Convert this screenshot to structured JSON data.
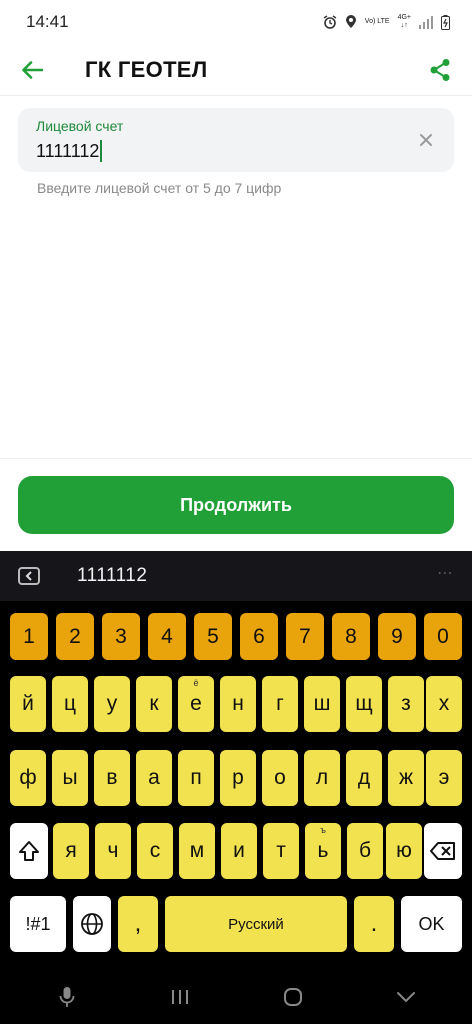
{
  "status": {
    "time": "14:41",
    "net_top": "Vo) LTE",
    "net_mid": "4G+"
  },
  "header": {
    "title": "ГК ГЕОТЕЛ"
  },
  "account_field": {
    "label": "Лицевой счет",
    "value": "1111112",
    "hint": "Введите лицевой счет от 5 до 7 цифр"
  },
  "continue_button": {
    "label": "Продолжить"
  },
  "keyboard": {
    "preview": "1111112",
    "more": "⋯",
    "numbers": [
      "1",
      "2",
      "3",
      "4",
      "5",
      "6",
      "7",
      "8",
      "9",
      "0"
    ],
    "row1": [
      "й",
      "ц",
      "у",
      "к",
      "е",
      "н",
      "г",
      "ш",
      "щ",
      "з",
      "х"
    ],
    "row1_alt": {
      "е": "ё"
    },
    "row2": [
      "ф",
      "ы",
      "в",
      "а",
      "п",
      "р",
      "о",
      "л",
      "д",
      "ж",
      "э"
    ],
    "row3": [
      "я",
      "ч",
      "с",
      "м",
      "и",
      "т",
      "ь",
      "б",
      "ю"
    ],
    "row3_alt": {
      "ь": "ъ"
    },
    "symbols_label": "!#1",
    "comma_label": ",",
    "space_label": "Русский",
    "period_label": ".",
    "ok_label": "OK",
    "colors": {
      "number_keys": "#e9a40c",
      "letter_keys": "#f2e250",
      "accent": "#21a038"
    }
  }
}
